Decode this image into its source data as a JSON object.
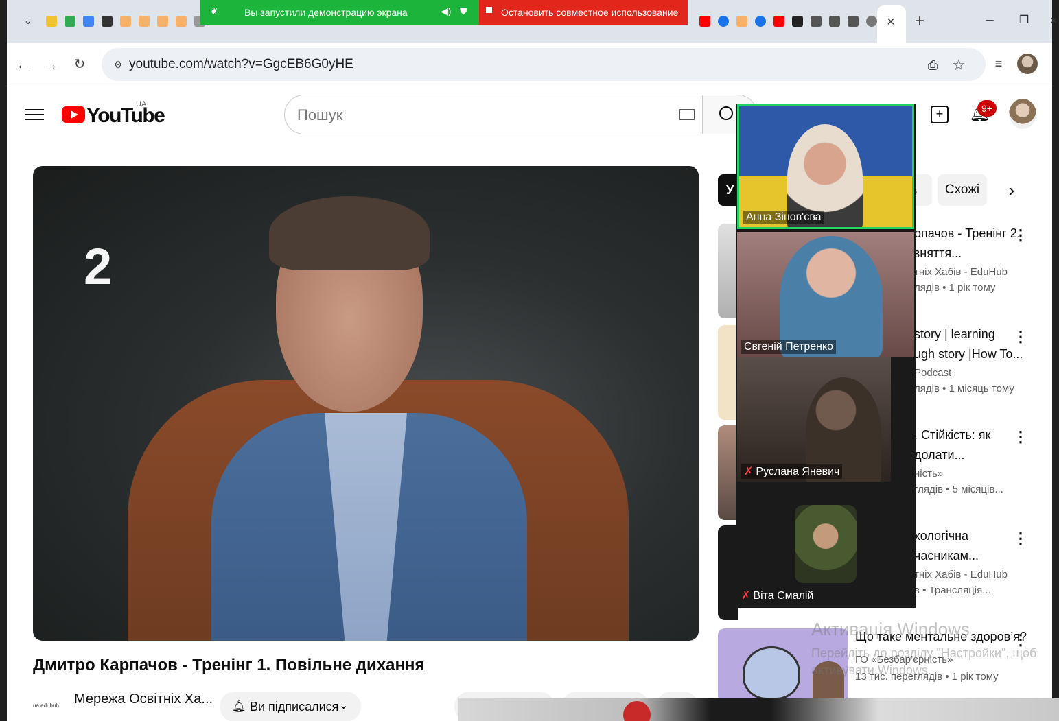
{
  "browser": {
    "tab_close": "×",
    "tab_new": "+",
    "url": "youtube.com/watch?v=GgcEB6G0yHE",
    "window_minimize": "–",
    "window_restore": "❐",
    "window_close": "×"
  },
  "screen_share": {
    "status": "Вы запустили демонстрацию экрана",
    "stop_label": "Остановить совместное использование",
    "active_color": "#1db43b",
    "stop_color": "#e1261c"
  },
  "youtube": {
    "country_code": "UA",
    "logo_text": "YouTube",
    "search_placeholder": "Пошук",
    "notifications_badge": "9+",
    "video": {
      "overlay_number": "2",
      "title": "Дмитро Карпачов - Тренінг 1. Повільне дихання",
      "channel_thumb_text": "ua eduhub",
      "channel": "Мережа Освітніх Ха...",
      "subscribe_label": "Ви підписалися"
    },
    "chips": {
      "first_partial": "У",
      "second_partial": "..",
      "similar": "Схожі"
    },
    "recommendations": [
      {
        "title_1": "рпачов - Тренінг 2.",
        "title_2": "зняття...",
        "channel": "тніх Хабів - EduHub",
        "meta": "лядів • 1 рік тому"
      },
      {
        "title_1": "story | learning",
        "title_2": "ugh story |How To...",
        "channel": "Podcast",
        "meta": "лядів • 1 місяць тому"
      },
      {
        "title_1": ". Стійкість: як",
        "title_2": "долати...",
        "channel": "ність»",
        "meta": "глядів • 5 місяців..."
      },
      {
        "title_1": "хологічна",
        "title_2": "часникам...",
        "channel": "тніх Хабів - EduHub",
        "meta": "в • Трансляція..."
      }
    ],
    "last_recommendation": {
      "title": "Що таке ментальне здоров’я?",
      "channel": "ГО «Безбар’єрність»",
      "meta": "13 тис. переглядів • 1 рік тому"
    }
  },
  "windows_watermark": {
    "title": "Активація Windows",
    "text": "Перейдіть до розділу \"Настройки\", щоб активувати Windows."
  },
  "meeting": {
    "participants": [
      {
        "name": "Анна Зінов'єва",
        "speaking": true,
        "muted": false
      },
      {
        "name": "Євгеній Петренко",
        "speaking": false,
        "muted": false
      },
      {
        "name": "Руслана Яневич",
        "speaking": false,
        "muted": true
      },
      {
        "name": "Віта Смалій",
        "speaking": false,
        "muted": true
      }
    ],
    "speaking_color": "#23d160"
  }
}
